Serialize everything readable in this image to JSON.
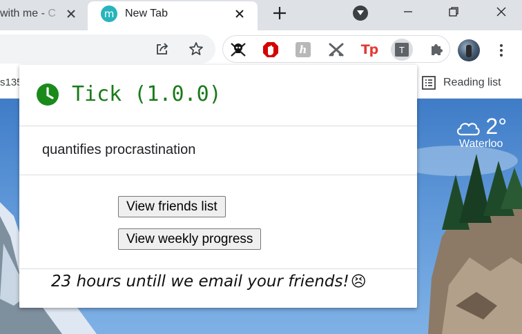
{
  "tabs": {
    "partial_tab_title": "with me - ",
    "partial_tab_fade": "C",
    "active_tab_title": "New Tab",
    "active_tab_favicon": "m"
  },
  "bookmarks": {
    "partial_item": "s135",
    "reading_list_label": "Reading list"
  },
  "weather": {
    "temperature": "2°",
    "city": "Waterloo",
    "icon": "cloud-icon"
  },
  "popup": {
    "title": "Tick (1.0.0)",
    "description": "quantifies procrastination",
    "view_friends_label": "View friends list",
    "view_weekly_label": "View weekly progress",
    "countdown_text": "23 hours untill we email your friends!",
    "countdown_emoji": "😣",
    "accent_color": "#1a7a1a"
  },
  "extensions": [
    "pirate-icon",
    "ublock-icon",
    "h-extension-icon",
    "cross-extension-icon",
    "tp-icon",
    "t-extension-icon",
    "puzzle-icon"
  ],
  "extension_labels": {
    "h": "h",
    "tp": "Tp",
    "t": "T"
  }
}
